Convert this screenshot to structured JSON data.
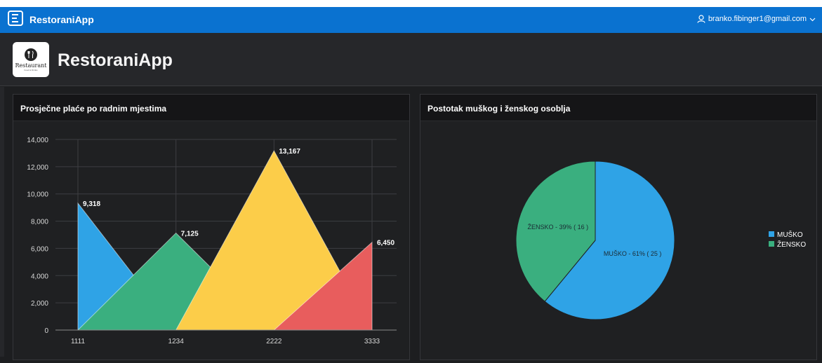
{
  "navbar": {
    "app_title": "RestoraniApp",
    "user_email": "branko.fibinger1@gmail.com",
    "menu_icon": "hamburger-menu-icon",
    "user_icon": "user-icon",
    "chevron_icon": "chevron-down-icon",
    "background": "#0a72d0"
  },
  "header": {
    "title": "RestoraniApp",
    "logo_text": "Restaurant",
    "logo_subtext": "Food & Drinks"
  },
  "regions": [
    {
      "title": "Prosječne plaće po radnim mjestima"
    },
    {
      "title": "Postotak muškog i ženskog osoblja"
    }
  ],
  "chart_data": [
    {
      "type": "area",
      "title": "Prosječne plaće po radnim mjestima",
      "categories": [
        "1111",
        "1234",
        "2222",
        "3333"
      ],
      "ylim": [
        0,
        14000
      ],
      "yticks": [
        "0",
        "2,000",
        "4,000",
        "6,000",
        "8,000",
        "10,000",
        "12,000",
        "14,000"
      ],
      "grid": true,
      "series": [
        {
          "value": 9318,
          "label": "9,318",
          "color": "#2fa3e6"
        },
        {
          "value": 7125,
          "label": "7,125",
          "color": "#3aaf7f"
        },
        {
          "value": 13167,
          "label": "13,167",
          "color": "#fccd49"
        },
        {
          "value": 6450,
          "label": "6,450",
          "color": "#e85d5d"
        }
      ]
    },
    {
      "type": "pie",
      "title": "Postotak muškog i ženskog osoblja",
      "legend_position": "right",
      "slices": [
        {
          "name": "MUŠKO",
          "value": 25,
          "percent": 61,
          "label": "MUŠKO - 61% ( 25 )",
          "color": "#2fa3e6"
        },
        {
          "name": "ŽENSKO",
          "value": 16,
          "percent": 39,
          "label": "ŽENSKO - 39% ( 16 )",
          "color": "#3aaf7f"
        }
      ]
    }
  ]
}
